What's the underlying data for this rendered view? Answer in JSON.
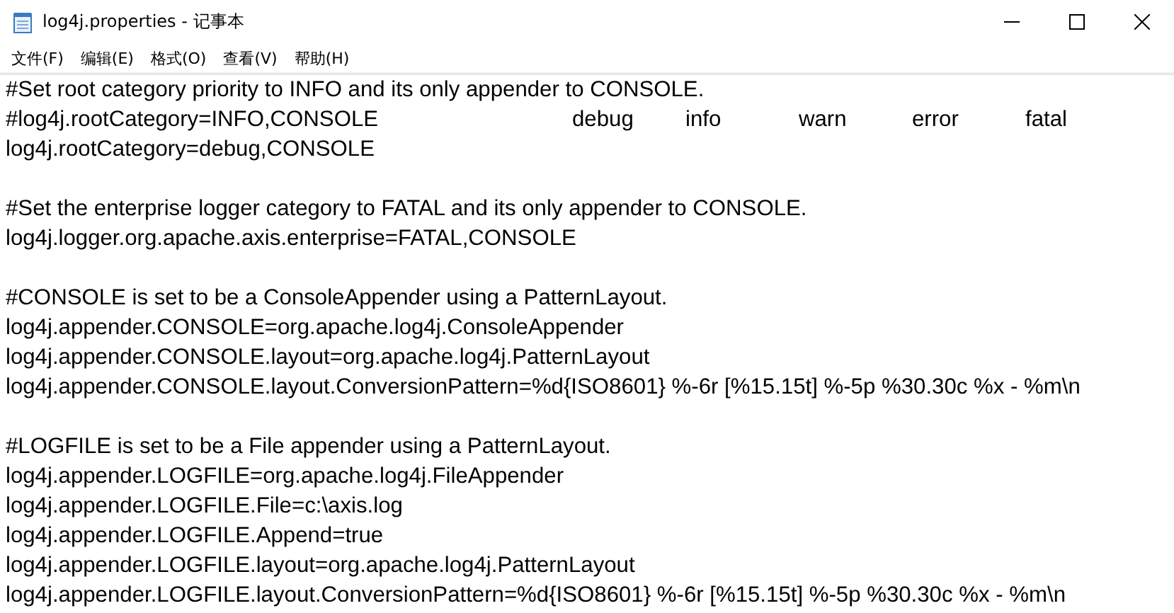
{
  "window": {
    "title": "log4j.properties - 记事本"
  },
  "menu": [
    "文件(F)",
    "编辑(E)",
    "格式(O)",
    "查看(V)",
    "帮助(H)"
  ],
  "editor": {
    "paragraphs": [
      [
        [
          "#Set root category priority to INFO and its only appender to CONSOLE."
        ],
        [
          "#log4j.rootCategory=INFO,CONSOLE",
          "debug",
          "info",
          "warn",
          "error",
          "fatal"
        ],
        [
          "log4j.rootCategory=debug,CONSOLE"
        ]
      ],
      [
        [
          "#Set the enterprise logger category to FATAL and its only appender to CONSOLE."
        ],
        [
          "log4j.logger.org.apache.axis.enterprise=FATAL,CONSOLE"
        ]
      ],
      [
        [
          "#CONSOLE is set to be a ConsoleAppender using a PatternLayout."
        ],
        [
          "log4j.appender.CONSOLE=org.apache.log4j.ConsoleAppender"
        ],
        [
          "log4j.appender.CONSOLE.layout=org.apache.log4j.PatternLayout"
        ],
        [
          "log4j.appender.CONSOLE.layout.ConversionPattern=%d{ISO8601} %-6r [%15.15t] %-5p %30.30c %x - %m\\n"
        ]
      ],
      [
        [
          "#LOGFILE is set to be a File appender using a PatternLayout."
        ],
        [
          "log4j.appender.LOGFILE=org.apache.log4j.FileAppender"
        ],
        [
          "log4j.appender.LOGFILE.File=c:\\axis.log"
        ],
        [
          "log4j.appender.LOGFILE.Append=true"
        ],
        [
          "log4j.appender.LOGFILE.layout=org.apache.log4j.PatternLayout"
        ],
        [
          "log4j.appender.LOGFILE.layout.ConversionPattern=%d{ISO8601} %-6r [%15.15t] %-5p %30.30c %x - %m\\n"
        ]
      ]
    ]
  }
}
